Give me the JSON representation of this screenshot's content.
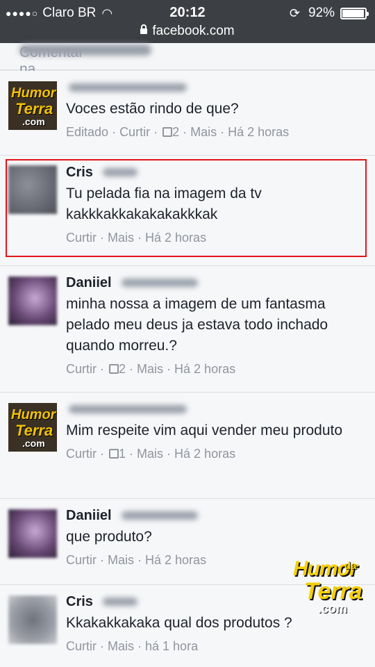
{
  "status_bar": {
    "carrier": "Claro BR",
    "time": "20:12",
    "battery": "92%",
    "battery_level": 0.92,
    "url": "facebook.com"
  },
  "comment_bar": {
    "label": "Comentar na publicação de"
  },
  "comments": [
    {
      "text": "Voces estão rindo de que?",
      "meta_edited": "Editado",
      "like": "Curtir",
      "likes": "2",
      "more": "Mais",
      "time": "Há 2 horas"
    },
    {
      "name": "Cris",
      "text": "Tu pelada fia na imagem da tv kakkkakkakakakakkkak",
      "like": "Curtir",
      "more": "Mais",
      "time": "Há 2 horas"
    },
    {
      "name": "Daniiel",
      "text": "minha nossa a imagem de um fantasma pelado meu deus ja estava todo inchado quando morreu.?",
      "like": "Curtir",
      "likes": "2",
      "more": "Mais",
      "time": "Há 2 horas"
    },
    {
      "text": "Mim respeite vim aqui vender meu produto",
      "like": "Curtir",
      "likes": "1",
      "more": "Mais",
      "time": "Há 2 horas"
    },
    {
      "name": "Daniiel",
      "text": "que produto?",
      "like": "Curtir",
      "more": "Mais",
      "time": "Há 2 horas"
    },
    {
      "name": "Cris",
      "text": "Kkakakkakaka qual dos produtos ?",
      "like": "Curtir",
      "more": "Mais",
      "time": "há 1 hora"
    }
  ],
  "watermark": {
    "line1": "Humor",
    "line1b": "da",
    "line2": "Terra",
    "line3": ".com"
  }
}
